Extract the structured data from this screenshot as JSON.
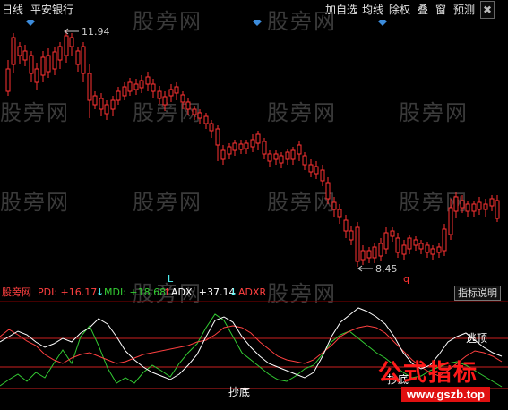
{
  "toolbar": {
    "period": "日线",
    "stock_name": "平安银行",
    "buttons": [
      "加自选",
      "均线",
      "除权",
      "叠",
      "窗",
      "预测"
    ],
    "close_symbol": "✖"
  },
  "watermark": "股旁网",
  "main_chart": {
    "high_label": "11.94",
    "low_label": "8.45",
    "low_marker": "q",
    "event_marker": "L",
    "up_color": "#ff3232",
    "down_color": "#54ffff",
    "diamond_color": "#3c8cdc"
  },
  "sub_chart": {
    "label": "股旁网",
    "pdi": "PDI: +16.17",
    "pdi_arrow": "↓",
    "mdi": "MDI: +18.68",
    "mdi_arrow": "↑",
    "adx": "ADX: +37.14",
    "adx_arrow": "↓",
    "adxr": "ADXR",
    "help_button": "指标说明",
    "annotations": {
      "bottom_buy": "抄底",
      "top_escape": "逃顶",
      "bottom_buy_2": "抄底"
    },
    "colors": {
      "pdi": "#ff4040",
      "mdi": "#33cc33",
      "adx": "#ffffff",
      "adxr": "#ff4040"
    }
  },
  "brand": {
    "title": "公式指标",
    "url": "www.gszb.top"
  }
}
